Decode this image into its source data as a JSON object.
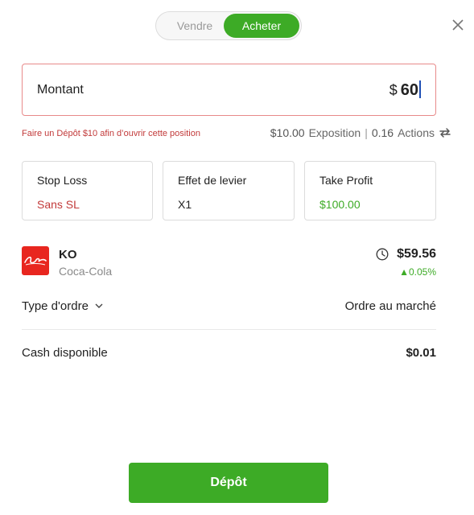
{
  "toggle": {
    "sell_label": "Vendre",
    "buy_label": "Acheter",
    "selected": "Acheter"
  },
  "amount": {
    "label": "Montant",
    "currency": "$",
    "value": "60"
  },
  "warning": "Faire un Dépôt $10 afin d’ouvrir cette position",
  "exposure": {
    "value": "$10.00",
    "label": "Exposition",
    "separator": "|",
    "units": "0.16",
    "units_label": "Actions"
  },
  "cards": {
    "stop_loss": {
      "title": "Stop Loss",
      "value": "Sans SL"
    },
    "leverage": {
      "title": "Effet de levier",
      "value": "X1"
    },
    "take_profit": {
      "title": "Take Profit",
      "value": "$100.00"
    }
  },
  "instrument": {
    "ticker": "KO",
    "name": "Coca-Cola",
    "price": "$59.56",
    "change": "0.05%"
  },
  "order_type": {
    "label": "Type d'ordre",
    "value": "Ordre au marché"
  },
  "cash": {
    "label": "Cash disponible",
    "value": "$0.01"
  },
  "deposit_button": "Dépôt",
  "colors": {
    "accent": "#3dab26",
    "error": "#c23a3a",
    "logo": "#e8261f"
  },
  "icons": [
    "close-icon",
    "switch-icon",
    "clock-icon",
    "chevron-down-icon",
    "coca-cola-logo"
  ]
}
